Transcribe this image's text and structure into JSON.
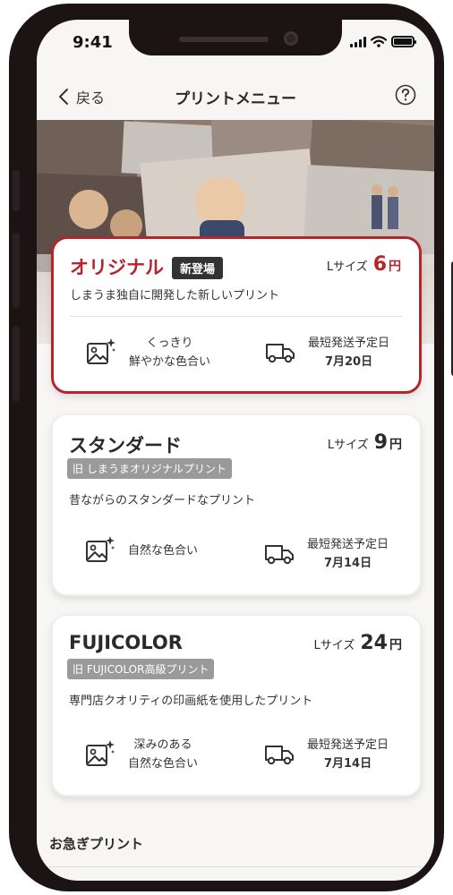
{
  "status_bar": {
    "time": "9:41"
  },
  "nav": {
    "back_label": "戻る",
    "title": "プリントメニュー"
  },
  "cards": [
    {
      "title": "オリジナル",
      "badge": "新登場",
      "size_label": "Lサイズ",
      "price": "6",
      "price_unit": "円",
      "description": "しまうま独自に開発した新しいプリント",
      "feature_left_lines": [
        "くっきり",
        "鮮やかな色合い"
      ],
      "shipping_label": "最短発送予定日",
      "shipping_date": "7月20日"
    },
    {
      "title": "スタンダード",
      "subtitle_badge": "旧 しまうまオリジナルプリント",
      "size_label": "Lサイズ",
      "price": "9",
      "price_unit": "円",
      "description": "昔ながらのスタンダードなプリント",
      "feature_left_lines": [
        "自然な色合い"
      ],
      "shipping_label": "最短発送予定日",
      "shipping_date": "7月14日"
    },
    {
      "title": "FUJICOLOR",
      "subtitle_badge": "旧 FUJICOLOR高級プリント",
      "size_label": "Lサイズ",
      "price": "24",
      "price_unit": "円",
      "description": "専門店クオリティの印画紙を使用したプリント",
      "feature_left_lines": [
        "深みのある",
        "自然な色合い"
      ],
      "shipping_label": "最短発送予定日",
      "shipping_date": "7月14日"
    }
  ],
  "section": {
    "title": "お急ぎプリント"
  },
  "colors": {
    "accent": "#b4252c",
    "badge_dark": "#333333",
    "badge_grey": "#9a9a9a",
    "bezel": "#1c1414"
  },
  "icons": [
    "back-chevron-icon",
    "help-icon",
    "photo-sparkle-icon",
    "delivery-truck-icon",
    "signal-icon",
    "wifi-icon",
    "battery-icon"
  ]
}
